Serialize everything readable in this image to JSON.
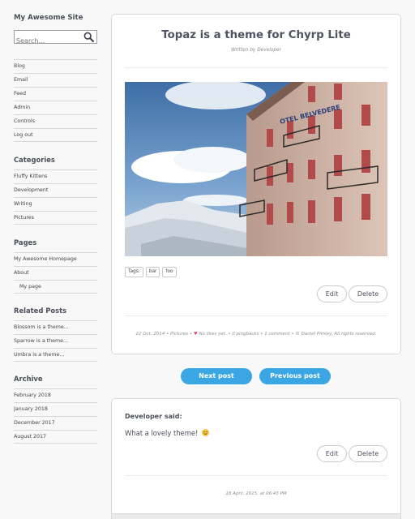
{
  "sidebar": {
    "site_title": "My Awesome Site",
    "search": {
      "placeholder": "Search..."
    },
    "links": [
      {
        "label": "Blog"
      },
      {
        "label": "Email"
      },
      {
        "label": "Feed"
      },
      {
        "label": "Admin"
      },
      {
        "label": "Controls"
      },
      {
        "label": "Log out"
      }
    ],
    "categories": {
      "title": "Categories",
      "items": [
        {
          "label": "Fluffy Kittens"
        },
        {
          "label": "Development"
        },
        {
          "label": "Writing"
        },
        {
          "label": "Pictures"
        }
      ]
    },
    "pages": {
      "title": "Pages",
      "items": [
        {
          "label": "My Awesome Homepage"
        },
        {
          "label": "About"
        },
        {
          "label": "My page"
        }
      ]
    },
    "related": {
      "title": "Related Posts",
      "items": [
        {
          "label": "Blossom is a theme..."
        },
        {
          "label": "Sparrow is a theme..."
        },
        {
          "label": "Umbra is a theme..."
        }
      ]
    },
    "archive": {
      "title": "Archive",
      "items": [
        {
          "label": "February 2018"
        },
        {
          "label": "January 2018"
        },
        {
          "label": "December 2017"
        },
        {
          "label": "August 2017"
        }
      ]
    }
  },
  "post": {
    "title": "Topaz is a theme for Chyrp Lite",
    "author": "Written by Developer",
    "tags_label": "Tags:",
    "tags": [
      "bar",
      "foo"
    ],
    "edit_label": "Edit",
    "delete_label": "Delete",
    "meta": {
      "date": "22 Oct, 2014",
      "category": "Pictures",
      "likes": "No likes yet.",
      "pingbacks": "0 pingbacks",
      "comments": "1 comment",
      "copyright": "© Daniel Pimley, All rights reserved."
    },
    "heart_color": "#e0487c"
  },
  "pagination": {
    "next_label": "Next post",
    "prev_label": "Previous post",
    "accent": "#3aa6e4"
  },
  "comment": {
    "author": "Developer said:",
    "text": "What a lovely theme!",
    "emoji": "slightly-smiling-face-icon",
    "edit_label": "Edit",
    "delete_label": "Delete",
    "date": "18 April, 2015, at 06:43 PM"
  }
}
